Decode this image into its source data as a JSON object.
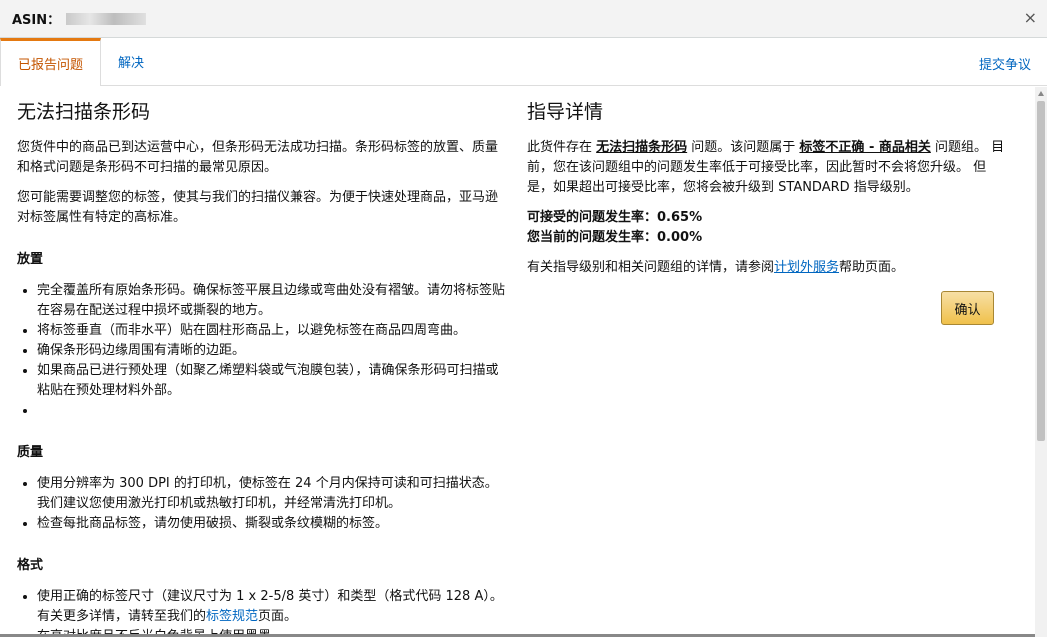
{
  "dialog": {
    "title_label": "ASIN：",
    "close_glyph": "×"
  },
  "tabs": [
    {
      "label": "已报告问题"
    },
    {
      "label": "解决"
    }
  ],
  "dispute_link": "提交争议",
  "left": {
    "heading": "无法扫描条形码",
    "para1": "您货件中的商品已到达运营中心，但条形码无法成功扫描。条形码标签的放置、质量和格式问题是条形码不可扫描的最常见原因。",
    "para2": "您可能需要调整您的标签，使其与我们的扫描仪兼容。为便于快速处理商品，亚马逊对标签属性有特定的高标准。",
    "sections": [
      {
        "title": "放置",
        "items": [
          "完全覆盖所有原始条形码。确保标签平展且边缘或弯曲处没有褶皱。请勿将标签贴在容易在配送过程中损坏或撕裂的地方。",
          "将标签垂直（而非水平）贴在圆柱形商品上，以避免标签在商品四周弯曲。",
          "确保条形码边缘周围有清晰的边距。",
          "如果商品已进行预处理（如聚乙烯塑料袋或气泡膜包装），请确保条形码可扫描或粘贴在预处理材料外部。",
          ""
        ]
      },
      {
        "title": "质量",
        "items": [
          "使用分辨率为 300 DPI 的打印机，使标签在 24 个月内保持可读和可扫描状态。我们建议您使用激光打印机或热敏打印机，并经常清洗打印机。",
          "检查每批商品标签，请勿使用破损、撕裂或条纹模糊的标签。"
        ]
      }
    ],
    "format_title": "格式",
    "format_item1_before": "使用正确的标签尺寸（建议尺寸为 1 x 2-5/8 英寸）和类型（格式代码 128 A）。有关更多详情，请转至我们的",
    "format_item1_link": "标签规范",
    "format_item1_after": "页面。",
    "format_item2": "在高对比度且不反光白色背景上使用黑墨。"
  },
  "right": {
    "heading": "指导详情",
    "p1_a": "此货件存在 ",
    "p1_b": "无法扫描条形码",
    "p1_c": " 问题。该问题属于 ",
    "p1_d": "标签不正确 - 商品相关",
    "p1_e": " 问题组。 目前，您在该问题组中的问题发生率低于可接受比率，因此暂时不会将您升级。 但是，如果超出可接受比率，您将会被升级到 STANDARD 指导级别。",
    "acceptable_rate": "可接受的问题发生率：0.65%",
    "current_rate": "您当前的问题发生率：0.00%",
    "help_before": "有关指导级别和相关问题组的详情，请参阅",
    "help_link": "计划外服务",
    "help_after": "帮助页面。",
    "confirm_button": "确认"
  }
}
